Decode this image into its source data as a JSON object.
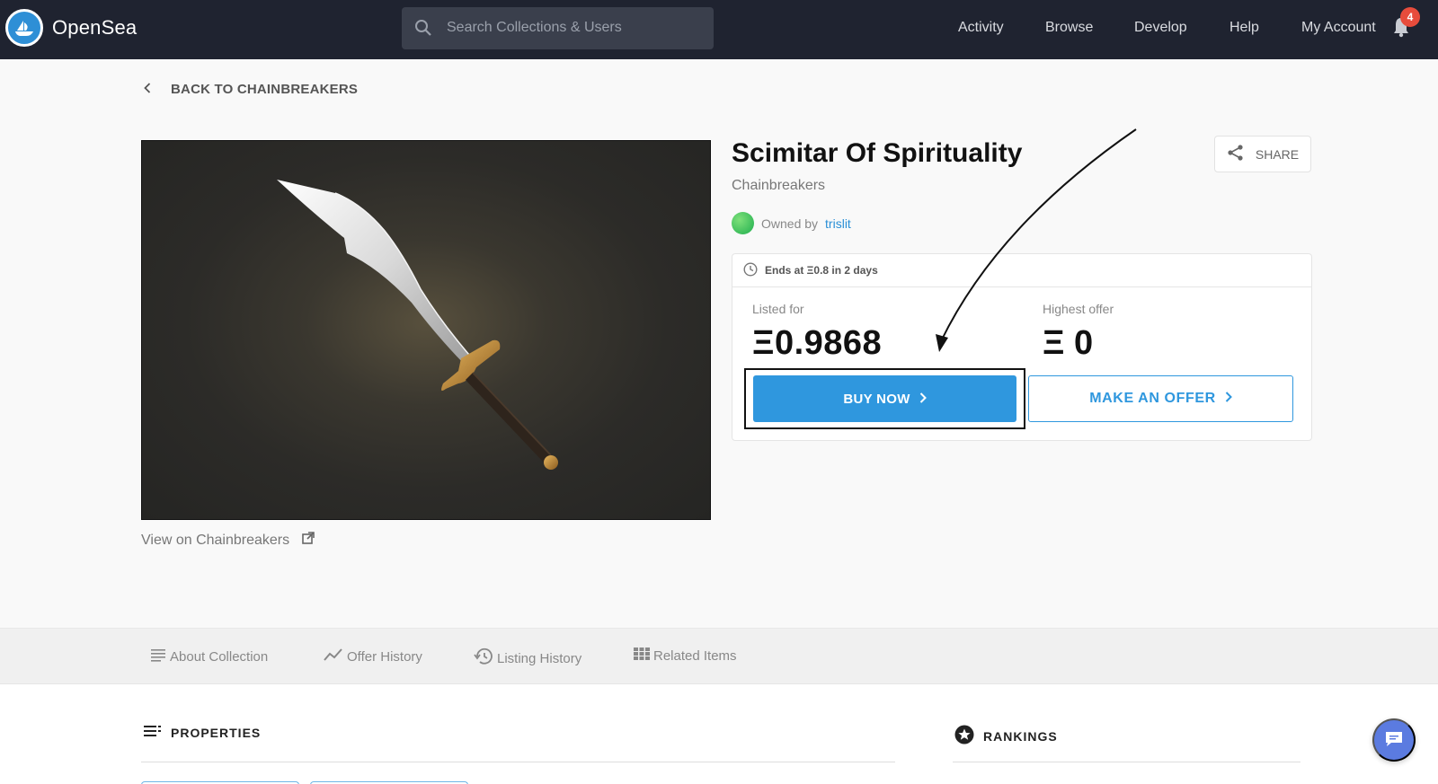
{
  "header": {
    "brand": "OpenSea",
    "search_placeholder": "Search Collections & Users",
    "nav": [
      "Activity",
      "Browse",
      "Develop",
      "Help",
      "My Account"
    ],
    "notification_count": "4"
  },
  "back_label": "BACK TO CHAINBREAKERS",
  "item": {
    "title": "Scimitar Of Spirituality",
    "collection": "Chainbreakers",
    "owned_by_label": "Owned by",
    "owner": "trislit",
    "view_link": "View on Chainbreakers",
    "share_label": "SHARE"
  },
  "sale": {
    "ends_text": "Ends at Ξ0.8 in 2 days",
    "listed_label": "Listed for",
    "listed_value": "Ξ0.9868",
    "offer_label": "Highest offer",
    "offer_value": "Ξ 0",
    "buy_label": "BUY NOW",
    "make_offer_label": "MAKE AN OFFER"
  },
  "tabs": [
    "About Collection",
    "Offer History",
    "Listing History",
    "Related Items"
  ],
  "sections": {
    "properties": "PROPERTIES",
    "rankings": "RANKINGS"
  },
  "colors": {
    "nav_bg": "#1f2330",
    "accent": "#2f97de",
    "badge": "#e74c3c",
    "chat": "#5b7be0"
  }
}
